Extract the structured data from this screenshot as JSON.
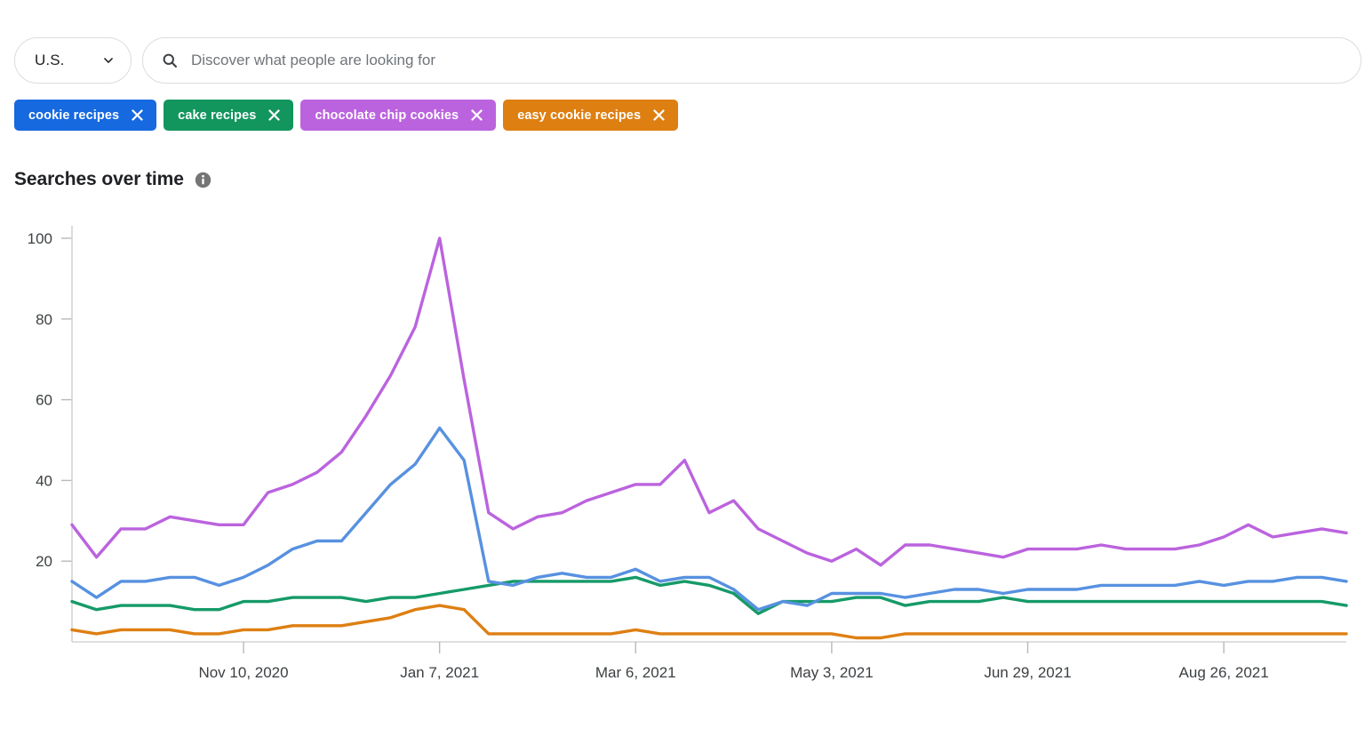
{
  "header": {
    "region": {
      "value": "U.S."
    },
    "search": {
      "placeholder": "Discover what people are looking for",
      "value": ""
    }
  },
  "chips": [
    {
      "label": "cookie recipes",
      "color": "#1669DF",
      "remove": "X"
    },
    {
      "label": "cake recipes",
      "color": "#13955E",
      "remove": "X"
    },
    {
      "label": "chocolate chip cookies",
      "color": "#BB63DE",
      "remove": "X"
    },
    {
      "label": "easy cookie recipes",
      "color": "#DE7F12",
      "remove": "X"
    }
  ],
  "chart_data": {
    "type": "line",
    "title": "Searches over time",
    "xlabel": "",
    "ylabel": "",
    "ylim": [
      0,
      100
    ],
    "yticks": [
      20,
      40,
      60,
      80,
      100
    ],
    "grid": false,
    "legend_position": "top-chips",
    "x_tick_labels": [
      "Nov 10, 2020",
      "Jan 7, 2021",
      "Mar 6, 2021",
      "May 3, 2021",
      "Jun 29, 2021",
      "Aug 26, 2021"
    ],
    "x_tick_indices": [
      7,
      15,
      23,
      31,
      39,
      47
    ],
    "n_points": 53,
    "series": [
      {
        "name": "cookie recipes",
        "color": "#5791E0",
        "values": [
          15,
          11,
          15,
          15,
          16,
          16,
          14,
          16,
          19,
          23,
          25,
          25,
          32,
          39,
          44,
          53,
          45,
          15,
          14,
          16,
          17,
          16,
          16,
          18,
          15,
          16,
          16,
          13,
          8,
          10,
          9,
          12,
          12,
          12,
          11,
          12,
          13,
          13,
          12,
          13,
          13,
          13,
          14,
          14,
          14,
          14,
          15,
          14,
          15,
          15,
          16,
          16,
          15
        ]
      },
      {
        "name": "cake recipes",
        "color": "#159A68",
        "values": [
          10,
          8,
          9,
          9,
          9,
          8,
          8,
          10,
          10,
          11,
          11,
          11,
          10,
          11,
          11,
          12,
          13,
          14,
          15,
          15,
          15,
          15,
          15,
          16,
          14,
          15,
          14,
          12,
          7,
          10,
          10,
          10,
          11,
          11,
          9,
          10,
          10,
          10,
          11,
          10,
          10,
          10,
          10,
          10,
          10,
          10,
          10,
          10,
          10,
          10,
          10,
          10,
          9
        ]
      },
      {
        "name": "chocolate chip cookies",
        "color": "#BB63DE",
        "values": [
          29,
          21,
          28,
          28,
          31,
          30,
          29,
          29,
          37,
          39,
          42,
          47,
          56,
          66,
          78,
          100,
          65,
          32,
          28,
          31,
          32,
          35,
          37,
          39,
          39,
          45,
          32,
          35,
          28,
          25,
          22,
          20,
          23,
          19,
          24,
          24,
          23,
          22,
          21,
          23,
          23,
          23,
          24,
          23,
          23,
          23,
          24,
          26,
          29,
          26,
          27,
          28,
          27
        ]
      },
      {
        "name": "easy cookie recipes",
        "color": "#DE7F12",
        "values": [
          3,
          2,
          3,
          3,
          3,
          2,
          2,
          3,
          3,
          4,
          4,
          4,
          5,
          6,
          8,
          9,
          8,
          2,
          2,
          2,
          2,
          2,
          2,
          3,
          2,
          2,
          2,
          2,
          2,
          2,
          2,
          2,
          1,
          1,
          2,
          2,
          2,
          2,
          2,
          2,
          2,
          2,
          2,
          2,
          2,
          2,
          2,
          2,
          2,
          2,
          2,
          2,
          2
        ]
      }
    ]
  }
}
